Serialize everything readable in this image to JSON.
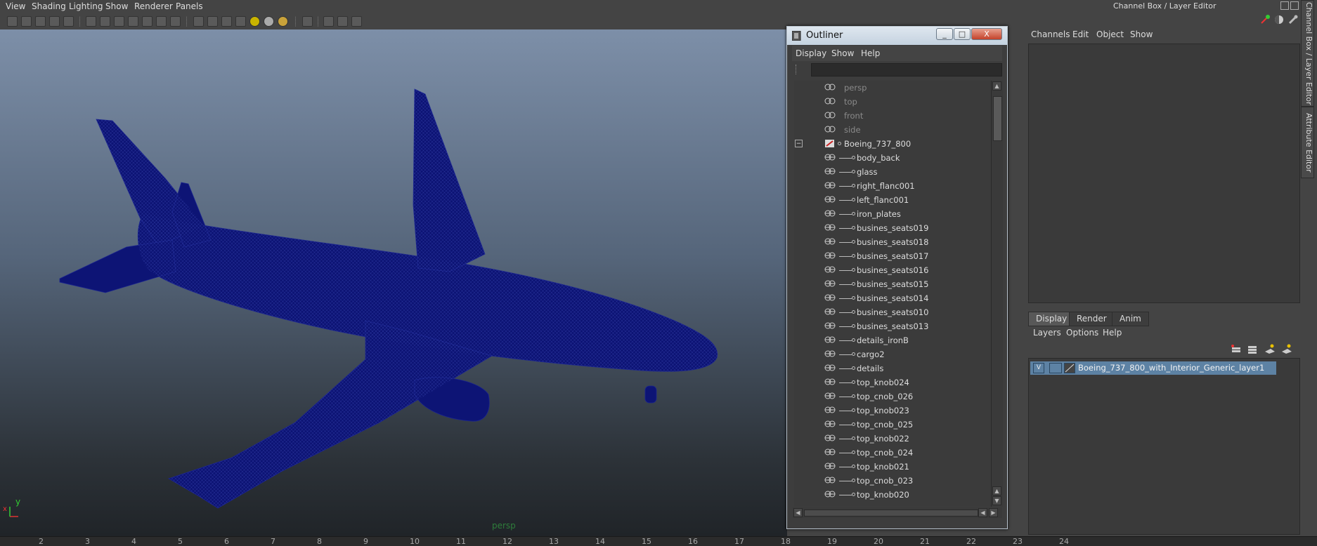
{
  "menu": [
    "View",
    "Shading",
    "Lighting",
    "Show",
    "Renderer",
    "Panels"
  ],
  "viewport": {
    "camera_label": "persp",
    "axis_x": "x",
    "axis_y": "y"
  },
  "timeline": {
    "ticks": [
      "2",
      "3",
      "4",
      "5",
      "6",
      "7",
      "8",
      "9",
      "10",
      "11",
      "12",
      "13",
      "14",
      "15",
      "16",
      "17",
      "18",
      "19",
      "20",
      "21",
      "22",
      "23",
      "24"
    ]
  },
  "outliner": {
    "title": "Outliner",
    "menu": [
      "Display",
      "Show",
      "Help"
    ],
    "cameras": [
      "persp",
      "top",
      "front",
      "side"
    ],
    "group": "Boeing_737_800",
    "group_toggle": "−",
    "objects": [
      "body_back",
      "glass",
      "right_flanc001",
      "left_flanc001",
      "iron_plates",
      "busines_seats019",
      "busines_seats018",
      "busines_seats017",
      "busines_seats016",
      "busines_seats015",
      "busines_seats014",
      "busines_seats010",
      "busines_seats013",
      "details_ironB",
      "cargo2",
      "details",
      "top_knob024",
      "top_cnob_026",
      "top_knob023",
      "top_cnob_025",
      "top_knob022",
      "top_cnob_024",
      "top_knob021",
      "top_cnob_023",
      "top_knob020"
    ],
    "window_buttons": {
      "minimize": "_",
      "maximize": "□",
      "close": "X"
    },
    "scroll_arrows": {
      "up": "▲",
      "down": "▼",
      "left": "◀",
      "right": "▶"
    }
  },
  "channel_box": {
    "title": "Channel Box / Layer Editor",
    "menu": [
      "Channels",
      "Edit",
      "Object",
      "Show"
    ]
  },
  "layer_editor": {
    "tabs": [
      "Display",
      "Render",
      "Anim"
    ],
    "active_tab": "Display",
    "menu": [
      "Layers",
      "Options",
      "Help"
    ],
    "layer": {
      "visibility": "V",
      "name": "Boeing_737_800_with_Interior_Generic_layer1"
    }
  },
  "side_tabs": [
    "Channel Box / Layer Editor",
    "Attribute Editor"
  ],
  "colors": {
    "wireframe": "#0d1475",
    "layer_selected": "#5d82a4",
    "persp_label": "#2e7d3b"
  }
}
